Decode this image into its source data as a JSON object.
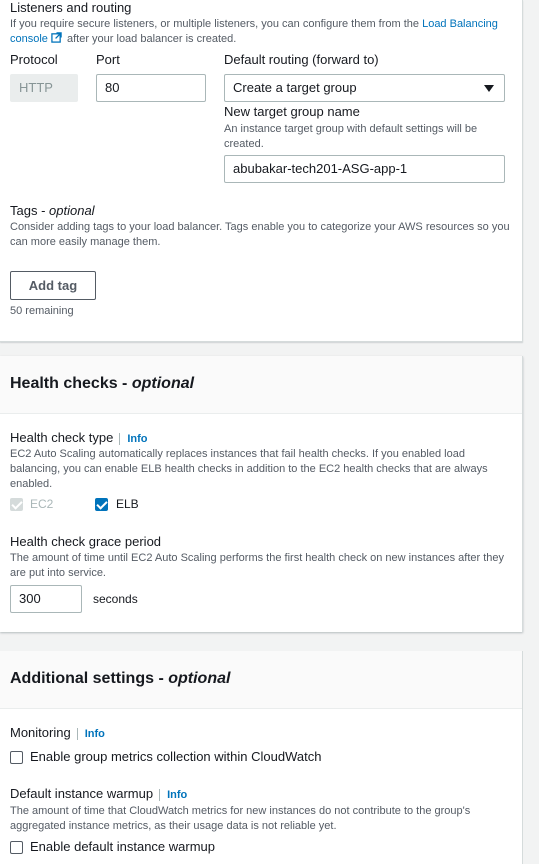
{
  "listeners": {
    "title": "Listeners and routing",
    "desc_before": "If you require secure listeners, or multiple listeners, you can configure them from the ",
    "link": "Load Balancing console",
    "desc_after": " after your load balancer is created.",
    "protocol_label": "Protocol",
    "protocol_value": "HTTP",
    "port_label": "Port",
    "port_value": "80",
    "routing_label": "Default routing (forward to)",
    "routing_value": "Create a target group",
    "tg_name_label": "New target group name",
    "tg_name_desc": "An instance target group with default settings will be created.",
    "tg_name_value": "abubakar-tech201-ASG-app-1"
  },
  "tags": {
    "label": "Tags",
    "optional": "optional",
    "desc": "Consider adding tags to your load balancer. Tags enable you to categorize your AWS resources so you can more easily manage them.",
    "add_button": "Add tag",
    "remaining": "50 remaining"
  },
  "health_checks": {
    "title": "Health checks -",
    "optional": "optional",
    "type_label": "Health check type",
    "info": "Info",
    "type_desc": "EC2 Auto Scaling automatically replaces instances that fail health checks. If you enabled load balancing, you can enable ELB health checks in addition to the EC2 health checks that are always enabled.",
    "ec2_label": "EC2",
    "elb_label": "ELB",
    "ec2_checked": true,
    "ec2_disabled": true,
    "elb_checked": true,
    "grace_label": "Health check grace period",
    "grace_desc": "The amount of time until EC2 Auto Scaling performs the first health check on new instances after they are put into service.",
    "grace_value": "300",
    "grace_unit": "seconds"
  },
  "additional": {
    "title": "Additional settings -",
    "optional": "optional",
    "monitoring_label": "Monitoring",
    "info": "Info",
    "metrics_label": "Enable group metrics collection within CloudWatch",
    "metrics_checked": false,
    "warmup_label": "Default instance warmup",
    "warmup_desc": "The amount of time that CloudWatch metrics for new instances do not contribute to the group's aggregated instance metrics, as their usage data is not reliable yet.",
    "warmup_checkbox_label": "Enable default instance warmup",
    "warmup_checked": false
  },
  "colors": {
    "link": "#0073bb",
    "checkbox_checked": "#0073bb",
    "panel_bg": "#ffffff",
    "page_bg": "#f2f3f3"
  }
}
